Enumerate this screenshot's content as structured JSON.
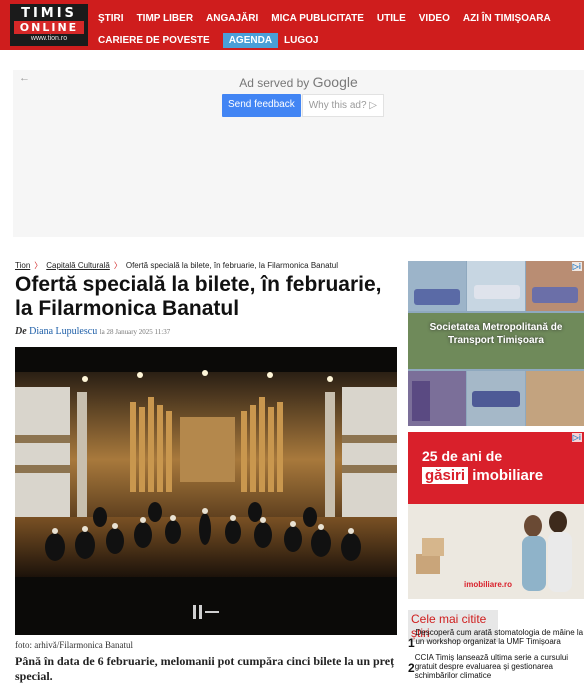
{
  "header": {
    "logo": {
      "top": "TIMIS",
      "middle": "ONLINE",
      "bottom": "www.tion.ro"
    },
    "nav_row1": [
      "ŞTIRI",
      "TIMP LIBER",
      "ANGAJĂRI",
      "MICA PUBLICITATE",
      "UTILE",
      "VIDEO",
      "AZI ÎN TIMIŞOARA"
    ],
    "nav_row2": [
      "CARIERE DE POVESTE",
      "AGENDA",
      "LUGOJ"
    ],
    "active_item": "AGENDA",
    "colors": {
      "header_bg": "#cf1d1d",
      "active_bg": "#4a9fd8"
    }
  },
  "ad": {
    "back_arrow": "←",
    "served_prefix": "Ad served by",
    "served_brand": "Google",
    "feedback_label": "Send feedback",
    "why_label": "Why this ad? ▷"
  },
  "breadcrumb": {
    "home": "Tion",
    "section": "Capitală Culturală",
    "current": "Ofertă specială la bilete, în februarie, la Filarmonica Banatul",
    "separator": "〉"
  },
  "article": {
    "title": "Ofertă specială la bilete, în februarie, la Filarmonica Banatul",
    "by_prefix": "De",
    "author": "Diana Lupulescu",
    "date": "la 28 January 2025 11:37",
    "photo_caption": "foto: arhivă/Filarmonica Banatul",
    "lead": "Până în data de 6 februarie, melomanii pot cumpăra cinci bilete la un preț special."
  },
  "sidebar": {
    "ad1_text_line1": "Societatea Metropolitană de",
    "ad1_text_line2": "Transport Timișoara",
    "ad2_headline_prefix": "25 de ani de",
    "ad2_brand_a": "găsiri",
    "ad2_brand_b": "imobiliare",
    "ad2_logo": "imobiliare.ro",
    "adchoices": "▷i",
    "most_read_title": "Cele mai citite știri",
    "most_read": [
      {
        "num": "1",
        "text": "Descoperă cum arată stomatologia de mâine la un workshop organizat la UMF Timișoara"
      },
      {
        "num": "2",
        "text": "CCIA Timiș lansează ultima serie a cursului gratuit despre evaluarea și gestionarea schimbărilor climatice"
      }
    ]
  }
}
